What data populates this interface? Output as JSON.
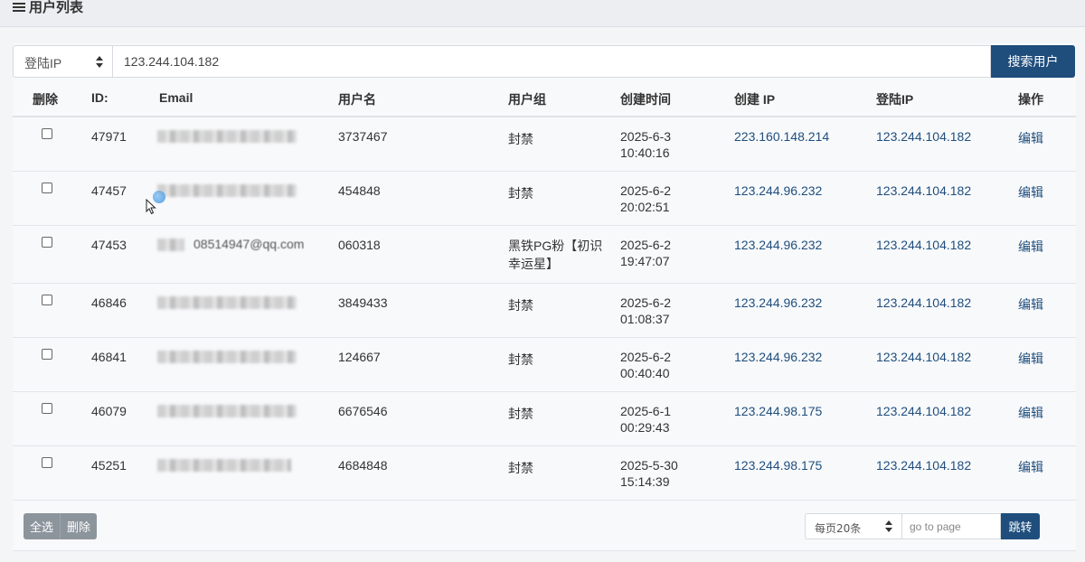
{
  "header": {
    "title": "用户列表",
    "icon": "list-icon"
  },
  "search": {
    "field_select": "登陆IP",
    "value": "123.244.104.182",
    "button": "搜索用户"
  },
  "columns": [
    "删除",
    "ID:",
    "Email",
    "用户名",
    "用户组",
    "创建时间",
    "创建 IP",
    "登陆IP",
    "操作"
  ],
  "rows": [
    {
      "id": "47971",
      "email": "",
      "username": "3737467",
      "group": "封禁",
      "created_date": "2025-6-3",
      "created_time": "10:40:16",
      "create_ip": "223.160.148.214",
      "login_ip": "123.244.104.182",
      "action": "编辑"
    },
    {
      "id": "47457",
      "email": "",
      "username": "454848",
      "group": "封禁",
      "created_date": "2025-6-2",
      "created_time": "20:02:51",
      "create_ip": "123.244.96.232",
      "login_ip": "123.244.104.182",
      "action": "编辑"
    },
    {
      "id": "47453",
      "email": "08514947@qq.com",
      "username": "060318",
      "group": "黑铁PG粉【初识幸运星】",
      "created_date": "2025-6-2",
      "created_time": "19:47:07",
      "create_ip": "123.244.96.232",
      "login_ip": "123.244.104.182",
      "action": "编辑"
    },
    {
      "id": "46846",
      "email": "",
      "username": "3849433",
      "group": "封禁",
      "created_date": "2025-6-2",
      "created_time": "01:08:37",
      "create_ip": "123.244.96.232",
      "login_ip": "123.244.104.182",
      "action": "编辑"
    },
    {
      "id": "46841",
      "email": "",
      "username": "124667",
      "group": "封禁",
      "created_date": "2025-6-2",
      "created_time": "00:40:40",
      "create_ip": "123.244.96.232",
      "login_ip": "123.244.104.182",
      "action": "编辑"
    },
    {
      "id": "46079",
      "email": "",
      "username": "6676546",
      "group": "封禁",
      "created_date": "2025-6-1",
      "created_time": "00:29:43",
      "create_ip": "123.244.98.175",
      "login_ip": "123.244.104.182",
      "action": "编辑"
    },
    {
      "id": "45251",
      "email": "",
      "username": "4684848",
      "group": "封禁",
      "created_date": "2025-5-30",
      "created_time": "15:14:39",
      "create_ip": "123.244.98.175",
      "login_ip": "123.244.104.182",
      "action": "编辑"
    }
  ],
  "footer": {
    "select_all": "全选",
    "delete": "删除",
    "page_size": "每页20条",
    "goto_placeholder": "go to page",
    "jump": "跳转"
  }
}
